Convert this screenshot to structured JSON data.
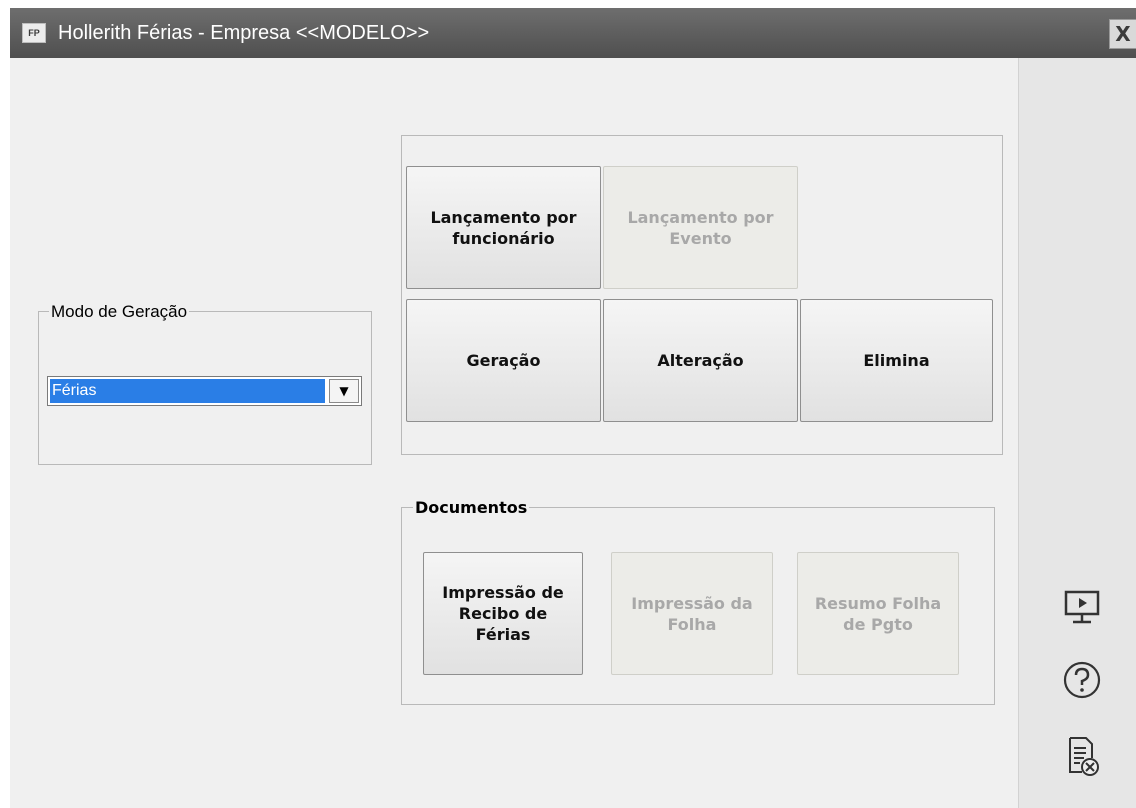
{
  "window": {
    "icon_label": "FP",
    "title": "Hollerith Férias - Empresa <<MODELO>>",
    "close_label": "X"
  },
  "modo_geracao": {
    "label": "Modo de Geração",
    "selected": "Férias"
  },
  "actions": [
    {
      "id": "lancamento-funcionario",
      "label": "Lançamento por funcionário",
      "enabled": true
    },
    {
      "id": "lancamento-evento",
      "label": "Lançamento por Evento",
      "enabled": false
    },
    {
      "id": "geracao",
      "label": "Geração",
      "enabled": true
    },
    {
      "id": "alteracao",
      "label": "Alteração",
      "enabled": true
    },
    {
      "id": "elimina",
      "label": "Elimina",
      "enabled": true
    }
  ],
  "documentos": {
    "label": "Documentos",
    "buttons": [
      {
        "id": "impressao-recibo",
        "label": "Impressão de Recibo de Férias",
        "enabled": true
      },
      {
        "id": "impressao-folha",
        "label": "Impressão da Folha",
        "enabled": false
      },
      {
        "id": "resumo-folha",
        "label": "Resumo Folha de Pgto",
        "enabled": false
      }
    ]
  },
  "side_icons": [
    "video-tutorial-icon",
    "help-icon",
    "close-document-icon"
  ]
}
